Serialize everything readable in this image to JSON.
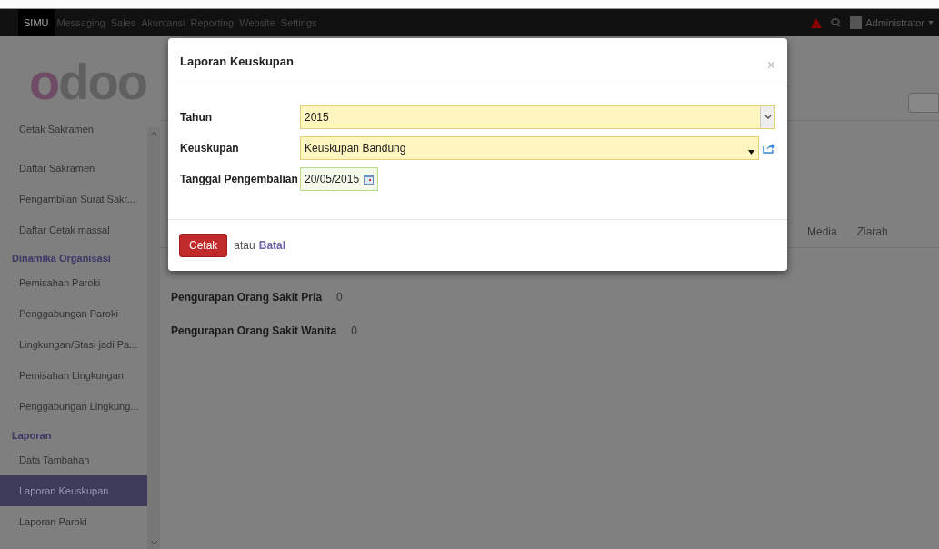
{
  "top_nav": {
    "menus": [
      {
        "label": "SIMU",
        "selected": true
      },
      {
        "label": "Messaging",
        "selected": false
      },
      {
        "label": "Sales",
        "selected": false
      },
      {
        "label": "Akuntansi",
        "selected": false
      },
      {
        "label": "Reporting",
        "selected": false
      },
      {
        "label": "Website",
        "selected": false
      },
      {
        "label": "Settings",
        "selected": false
      }
    ],
    "user": "Administrator"
  },
  "logo": "odoo",
  "sidebar": {
    "groups": [
      {
        "items": [
          {
            "label": "Cetak Sakramen",
            "selected": false
          },
          {
            "label": "Daftar Sakramen",
            "selected": false
          },
          {
            "label": "Pengambilan Surat Sakr...",
            "selected": false
          },
          {
            "label": "Daftar Cetak massal",
            "selected": false
          }
        ]
      },
      {
        "title": "Dinamika Organisasi",
        "items": [
          {
            "label": "Pemisahan Paroki",
            "selected": false
          },
          {
            "label": "Penggabungan Paroki",
            "selected": false
          },
          {
            "label": "Lingkungan/Stasi jadi Pa...",
            "selected": false
          },
          {
            "label": "Pemisahan Lingkungan",
            "selected": false
          },
          {
            "label": "Penggabungan Lingkung...",
            "selected": false
          }
        ]
      },
      {
        "title": "Laporan",
        "items": [
          {
            "label": "Data Tambahan",
            "selected": false
          },
          {
            "label": "Laporan Keuskupan",
            "selected": true
          },
          {
            "label": "Laporan Paroki",
            "selected": false
          }
        ]
      }
    ]
  },
  "form": {
    "tabs": [
      "Media",
      "Ziarah"
    ],
    "fields": [
      {
        "label": "Pengurapan Orang Sakit Pria",
        "value": "0"
      },
      {
        "label": "Pengurapan Orang Sakit Wanita",
        "value": "0"
      }
    ]
  },
  "dialog": {
    "title": "Laporan Keuskupan",
    "close": "×",
    "fields": [
      {
        "kind": "select",
        "label": "Tahun",
        "value": "2015"
      },
      {
        "kind": "many2one",
        "label": "Keuskupan",
        "value": "Keuskupan Bandung"
      },
      {
        "kind": "date",
        "label": "Tanggal Pengembalian",
        "value": "20/05/2015"
      }
    ],
    "primary_button": "Cetak",
    "separator": "atau",
    "cancel_link": "Batal"
  }
}
